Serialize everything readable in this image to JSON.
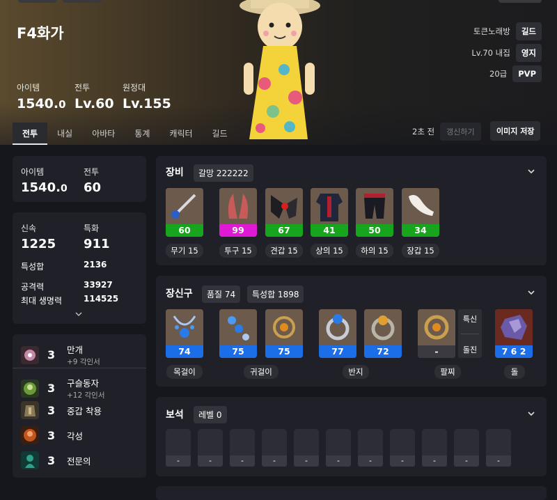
{
  "header": {
    "character_name": "F4화가",
    "stats": [
      {
        "label": "아이템",
        "value_main": "1540.",
        "value_small": "0"
      },
      {
        "label": "전투",
        "value_main": "Lv.60",
        "value_small": ""
      },
      {
        "label": "원정대",
        "value_main": "Lv.155",
        "value_small": ""
      }
    ],
    "right_info": [
      {
        "text": "토큰노래방",
        "badge": "길드"
      },
      {
        "text": "Lv.70 내집",
        "badge": "영지"
      },
      {
        "text": "20급",
        "badge": "PVP"
      }
    ],
    "tabs": [
      "전투",
      "내실",
      "아바타",
      "통계",
      "캐릭터",
      "길드"
    ],
    "active_tab": "전투",
    "updated_ago": "2초 전",
    "refresh_label": "갱신하기",
    "save_image_label": "이미지 저장"
  },
  "left": {
    "summary": {
      "item_label": "아이템",
      "item_main": "1540.",
      "item_small": "0",
      "combat_label": "전투",
      "combat_value": "60"
    },
    "stats": {
      "swiftness_label": "신속",
      "swiftness_value": "1225",
      "specialization_label": "특화",
      "specialization_value": "911",
      "total_label": "특성합",
      "total_value": "2136",
      "attack_label": "공격력",
      "attack_value": "33927",
      "hp_label": "최대 생명력",
      "hp_value": "114525"
    },
    "engravings": [
      {
        "level": "3",
        "name": "만개",
        "sub": "+9 각인서",
        "color": "#c28aa8"
      },
      {
        "level": "3",
        "name": "구슬동자",
        "sub": "+12 각인서",
        "color": "#6a9a3a"
      },
      {
        "level": "3",
        "name": "중갑 착용",
        "sub": "",
        "color": "#8a7a5a"
      },
      {
        "level": "3",
        "name": "각성",
        "sub": "",
        "color": "#c2541e"
      },
      {
        "level": "3",
        "name": "전문의",
        "sub": "",
        "color": "#2fa08a"
      }
    ]
  },
  "equipment": {
    "title": "장비",
    "chip": "갈망 222222",
    "items": [
      {
        "value": "60",
        "label": "무기 15",
        "color": "#17a51d",
        "icon": "weapon-icon"
      },
      {
        "value": "99",
        "label": "투구 15",
        "color": "#e01ad4",
        "icon": "helmet-icon"
      },
      {
        "value": "67",
        "label": "견갑 15",
        "color": "#17a51d",
        "icon": "shoulder-icon"
      },
      {
        "value": "41",
        "label": "상의 15",
        "color": "#17a51d",
        "icon": "chest-icon"
      },
      {
        "value": "50",
        "label": "하의 15",
        "color": "#17a51d",
        "icon": "pants-icon"
      },
      {
        "value": "34",
        "label": "장갑 15",
        "color": "#17a51d",
        "icon": "gloves-icon"
      }
    ]
  },
  "accessories": {
    "title": "장신구",
    "chip_quality": "품질 74",
    "chip_total": "특성합 1898",
    "items": [
      {
        "value": "74",
        "color": "#1c6ee8",
        "icon": "necklace-icon"
      },
      {
        "value": "75",
        "color": "#1c6ee8",
        "icon": "earring-icon"
      },
      {
        "value": "75",
        "color": "#1c6ee8",
        "icon": "earring-icon"
      },
      {
        "value": "77",
        "color": "#1c6ee8",
        "icon": "ring-icon"
      },
      {
        "value": "72",
        "color": "#1c6ee8",
        "icon": "ring-icon"
      },
      {
        "value": "-",
        "color": "#3a3a40",
        "icon": "bracelet-icon"
      },
      {
        "value": "7 6 2",
        "color": "#1c6ee8",
        "icon": "stone-icon"
      }
    ],
    "bracelet_stats": [
      "특신",
      "돌진"
    ],
    "labels": [
      "목걸이",
      "귀걸이",
      "반지",
      "팔찌",
      "돌"
    ]
  },
  "gems": {
    "title": "보석",
    "chip": "레벨 0",
    "slots": [
      "-",
      "-",
      "-",
      "-",
      "-",
      "-",
      "-",
      "-",
      "-",
      "-",
      "-"
    ]
  }
}
